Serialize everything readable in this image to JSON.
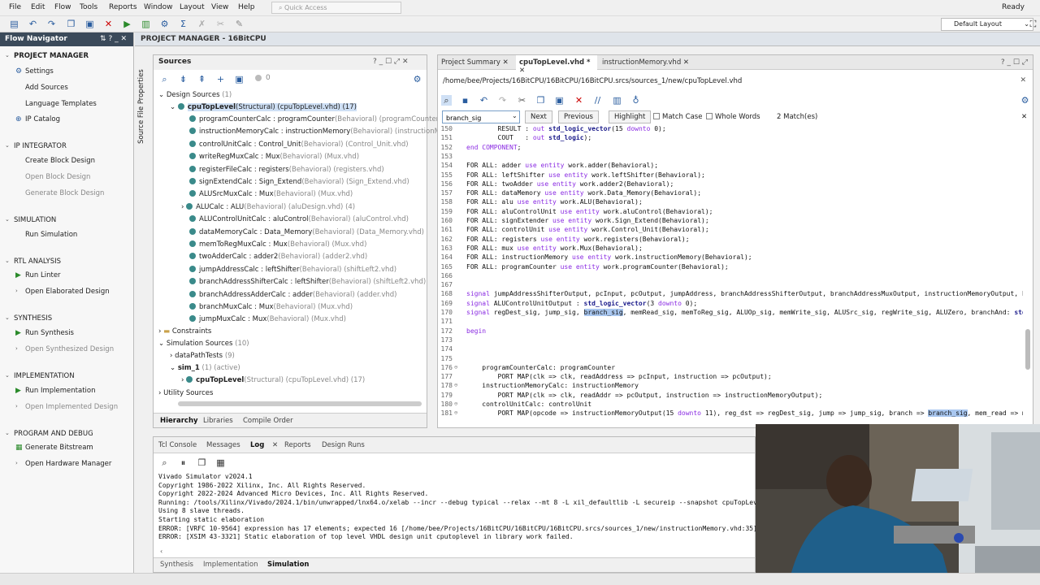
{
  "menu": [
    "File",
    "Edit",
    "Flow",
    "Tools",
    "Reports",
    "Window",
    "Layout",
    "View",
    "Help"
  ],
  "quick_access_placeholder": "Quick Access",
  "status_ready": "Ready",
  "layout_select": "Default Layout",
  "flow_navigator": {
    "title": "Flow Navigator",
    "project_manager": "PROJECT MANAGER",
    "settings": "Settings",
    "add_sources": "Add Sources",
    "language_templates": "Language Templates",
    "ip_catalog": "IP Catalog",
    "ip_integrator": "IP INTEGRATOR",
    "create_block_design": "Create Block Design",
    "open_block_design": "Open Block Design",
    "generate_block_design": "Generate Block Design",
    "simulation": "SIMULATION",
    "run_simulation": "Run Simulation",
    "rtl_analysis": "RTL ANALYSIS",
    "run_linter": "Run Linter",
    "open_elaborated": "Open Elaborated Design",
    "synthesis": "SYNTHESIS",
    "run_synthesis": "Run Synthesis",
    "open_synthesized": "Open Synthesized Design",
    "implementation": "IMPLEMENTATION",
    "run_implementation": "Run Implementation",
    "open_implemented": "Open Implemented Design",
    "program_debug": "PROGRAM AND DEBUG",
    "generate_bitstream": "Generate Bitstream",
    "open_hw_manager": "Open Hardware Manager"
  },
  "project_manager_title": "PROJECT MANAGER - 16BitCPU",
  "source_file_properties": "Source File Properties",
  "sources": {
    "title": "Sources",
    "count_badge": "0",
    "design_sources": "Design Sources",
    "design_sources_count": "(1)",
    "top_name": "cpuTopLevel",
    "top_detail": "(Structural) (cpuTopLevel.vhd) (17)",
    "items": [
      {
        "inst": "programCounterCalc : programCounter",
        "detail": "(Behavioral) (programCounter.vhd)"
      },
      {
        "inst": "instructionMemoryCalc : instructionMemory",
        "detail": "(Behavioral) (instructionMemor"
      },
      {
        "inst": "controlUnitCalc : Control_Unit",
        "detail": "(Behavioral) (Control_Unit.vhd)"
      },
      {
        "inst": "writeRegMuxCalc : Mux",
        "detail": "(Behavioral) (Mux.vhd)"
      },
      {
        "inst": "registerFileCalc : registers",
        "detail": "(Behavioral) (registers.vhd)"
      },
      {
        "inst": "signExtendCalc : Sign_Extend",
        "detail": "(Behavioral) (Sign_Extend.vhd)"
      },
      {
        "inst": "ALUSrcMuxCalc : Mux",
        "detail": "(Behavioral) (Mux.vhd)"
      },
      {
        "inst": "ALUCalc : ALU",
        "detail": "(Behavioral) (aluDesign.vhd) (4)"
      },
      {
        "inst": "ALUControlUnitCalc : aluControl",
        "detail": "(Behavioral) (aluControl.vhd)"
      },
      {
        "inst": "dataMemoryCalc : Data_Memory",
        "detail": "(Behavioral) (Data_Memory.vhd)"
      },
      {
        "inst": "memToRegMuxCalc : Mux",
        "detail": "(Behavioral) (Mux.vhd)"
      },
      {
        "inst": "twoAdderCalc : adder2",
        "detail": "(Behavioral) (adder2.vhd)"
      },
      {
        "inst": "jumpAddressCalc : leftShifter",
        "detail": "(Behavioral) (shiftLeft2.vhd)"
      },
      {
        "inst": "branchAddressShifterCalc : leftShifter",
        "detail": "(Behavioral) (shiftLeft2.vhd)"
      },
      {
        "inst": "branchAddressAdderCalc : adder",
        "detail": "(Behavioral) (adder.vhd)"
      },
      {
        "inst": "branchMuxCalc : Mux",
        "detail": "(Behavioral) (Mux.vhd)"
      },
      {
        "inst": "jumpMuxCalc : Mux",
        "detail": "(Behavioral) (Mux.vhd)"
      }
    ],
    "constraints": "Constraints",
    "sim_sources": "Simulation Sources",
    "sim_sources_count": "(10)",
    "datapath_tests": "dataPathTests",
    "datapath_count": "(9)",
    "sim_1": "sim_1",
    "sim_1_state": "(1) (active)",
    "sim_top": "cpuTopLevel",
    "sim_top_detail": "(Structural) (cpuTopLevel.vhd) (17)",
    "utility_sources": "Utility Sources",
    "tabs": [
      "Hierarchy",
      "Libraries",
      "Compile Order"
    ]
  },
  "editor": {
    "tabs": [
      "Project Summary",
      "cpuTopLevel.vhd *",
      "instructionMemory.vhd"
    ],
    "path": "/home/bee/Projects/16BitCPU/16BitCPU/16BitCPU.srcs/sources_1/new/cpuTopLevel.vhd",
    "find_value": "branch_sig",
    "next": "Next",
    "previous": "Previous",
    "highlight": "Highlight",
    "match_case": "Match Case",
    "whole_words": "Whole Words",
    "matches": "2 Match(es)",
    "lines": [
      {
        "n": "150",
        "t": "        RESULT : out std_logic_vector(15 downto 0);"
      },
      {
        "n": "151",
        "t": "        COUT   : out std_logic);"
      },
      {
        "n": "152",
        "t": "end COMPONENT;"
      },
      {
        "n": "153",
        "t": ""
      },
      {
        "n": "154",
        "t": "FOR ALL: adder use entity work.adder(Behavioral);"
      },
      {
        "n": "155",
        "t": "FOR ALL: leftShifter use entity work.leftShifter(Behavioral);"
      },
      {
        "n": "156",
        "t": "FOR ALL: twoAdder use entity work.adder2(Behavioral);"
      },
      {
        "n": "157",
        "t": "FOR ALL: dataMemory use entity work.Data_Memory(Behavioral);"
      },
      {
        "n": "158",
        "t": "FOR ALL: alu use entity work.ALU(Behavioral);"
      },
      {
        "n": "159",
        "t": "FOR ALL: aluControlUnit use entity work.aluControl(Behavioral);"
      },
      {
        "n": "160",
        "t": "FOR ALL: signExtender use entity work.Sign_Extend(Behavioral);"
      },
      {
        "n": "161",
        "t": "FOR ALL: controlUnit use entity work.Control_Unit(Behavioral);"
      },
      {
        "n": "162",
        "t": "FOR ALL: registers use entity work.registers(Behavioral);"
      },
      {
        "n": "163",
        "t": "FOR ALL: mux use entity work.Mux(Behavioral);"
      },
      {
        "n": "164",
        "t": "FOR ALL: instructionMemory use entity work.instructionMemory(Behavioral);"
      },
      {
        "n": "165",
        "t": "FOR ALL: programCounter use entity work.programCounter(Behavioral);"
      },
      {
        "n": "166",
        "t": ""
      },
      {
        "n": "167",
        "t": ""
      },
      {
        "n": "168",
        "t": "signal jumpAddressShifterOutput, pcInput, pcOutput, jumpAddress, branchAddressShifterOutput, branchAddressMuxOutput, instructionMemoryOutput, bran"
      },
      {
        "n": "169",
        "t": "signal ALUControlUnitOutput : std_logic_vector(3 downto 0);"
      },
      {
        "n": "170",
        "t": "signal regDest_sig, jump_sig, branch_sig, memRead_sig, memToReg_sig, ALUOp_sig, memWrite_sig, ALUSrc_sig, regWrite_sig, ALUZero, branchAnd: std_lo"
      },
      {
        "n": "171",
        "t": ""
      },
      {
        "n": "172",
        "t": "begin"
      },
      {
        "n": "173",
        "t": ""
      },
      {
        "n": "174",
        "t": ""
      },
      {
        "n": "175",
        "t": ""
      },
      {
        "n": "176",
        "t": "    programCounterCalc: programCounter"
      },
      {
        "n": "177",
        "t": "        PORT MAP(clk => clk, readAddress => pcInput, instruction => pcOutput);"
      },
      {
        "n": "178",
        "t": "    instructionMemoryCalc: instructionMemory"
      },
      {
        "n": "179",
        "t": "        PORT MAP(clk => clk, readAddr => pcOutput, instruction => instructionMemoryOutput);"
      },
      {
        "n": "180",
        "t": "    controlUnitCalc: controlUnit"
      },
      {
        "n": "181",
        "t": "        PORT MAP(opcode => instructionMemoryOutput(15 downto 11), reg_dst => regDest_sig, jump => jump_sig, branch => branch_sig, mem_read => memR"
      }
    ]
  },
  "log": {
    "tabs": [
      "Tcl Console",
      "Messages",
      "Log",
      "Reports",
      "Design Runs"
    ],
    "lines": [
      "Vivado Simulator v2024.1",
      "Copyright 1986-2022 Xilinx, Inc. All Rights Reserved.",
      "Copyright 2022-2024 Advanced Micro Devices, Inc. All Rights Reserved.",
      "Running: /tools/Xilinx/Vivado/2024.1/bin/unwrapped/lnx64.o/xelab --incr --debug typical --relax --mt 8 -L xil_defaultlib -L secureip --snapshot cpuTopLevel_be",
      "Using 8 slave threads.",
      "Starting static elaboration",
      "ERROR: [VRFC 10-9564] expression has 17 elements; expected 16 [/home/bee/Projects/16BitCPU/16BitCPU/16BitCPU.srcs/sources_1/new/instructionMemory.vhd:35]",
      "ERROR: [XSIM 43-3321] Static elaboration of top level VHDL design unit cputoplevel in library work failed."
    ],
    "bottom_tabs": [
      "Synthesis",
      "Implementation",
      "Simulation"
    ]
  },
  "colors": {
    "header_dark": "#3b4a5a",
    "accent_blue": "#2a5d9f",
    "run_green": "#2a8a2a",
    "highlight": "#a9c7f0"
  }
}
